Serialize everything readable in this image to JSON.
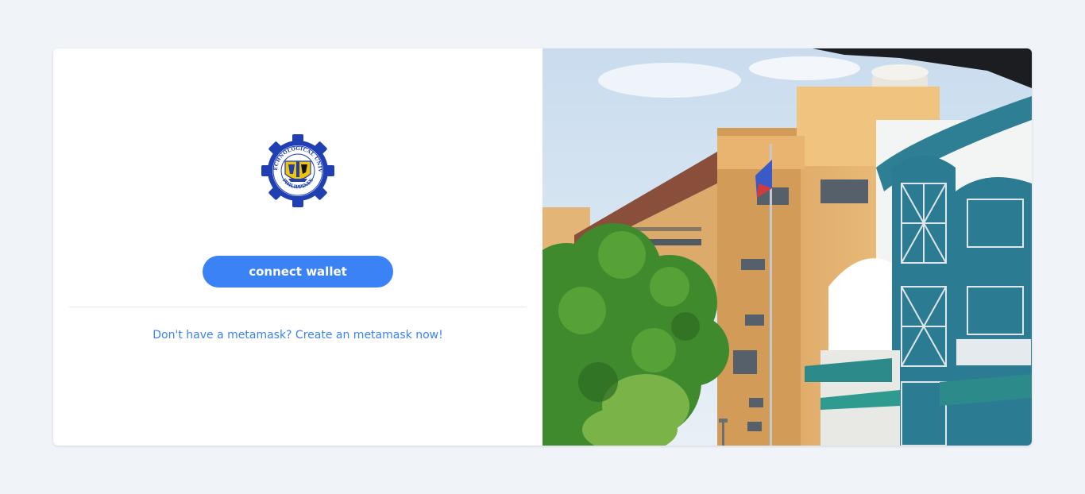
{
  "login": {
    "logo_name": "Rizal Technological University seal",
    "logo_text_top": "RIZAL TECHNOLOGICAL UNIVERSITY",
    "logo_text_bottom": "PHILIPPINES",
    "connect_label": "connect wallet",
    "create_link": "Don't have a metamask? Create an metamask now!"
  },
  "colors": {
    "background": "#f0f3f8",
    "accent": "#3b82f6",
    "seal_blue": "#1f3fb3",
    "seal_gold": "#f2c400"
  },
  "photo": {
    "subject": "campus-building-photo"
  }
}
